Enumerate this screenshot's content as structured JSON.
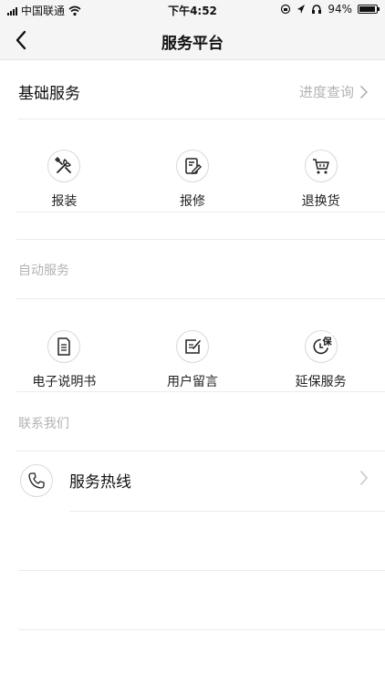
{
  "status_bar": {
    "carrier": "中国联通",
    "time": "下午4:52",
    "battery": "94%",
    "battery_level": 0.94
  },
  "navbar": {
    "title": "服务平台",
    "back_icon": "chevron-left-icon"
  },
  "basic_services": {
    "title": "基础服务",
    "progress_link": "进度查询",
    "items": [
      {
        "label": "报装",
        "icon": "tools-icon"
      },
      {
        "label": "报修",
        "icon": "repair-form-icon"
      },
      {
        "label": "退换货",
        "icon": "cart-icon"
      }
    ]
  },
  "self_service": {
    "title": "自动服务",
    "items": [
      {
        "label": "电子说明书",
        "icon": "document-icon"
      },
      {
        "label": "用户留言",
        "icon": "edit-note-icon"
      },
      {
        "label": "延保服务",
        "icon": "warranty-icon",
        "badge": "保"
      }
    ]
  },
  "contact": {
    "title": "联系我们",
    "hotline_label": "服务热线",
    "hotline_icon": "phone-icon"
  },
  "colors": {
    "muted": "#b3b3b3",
    "divider": "#ececec",
    "header_bg": "#f5f5f5"
  }
}
